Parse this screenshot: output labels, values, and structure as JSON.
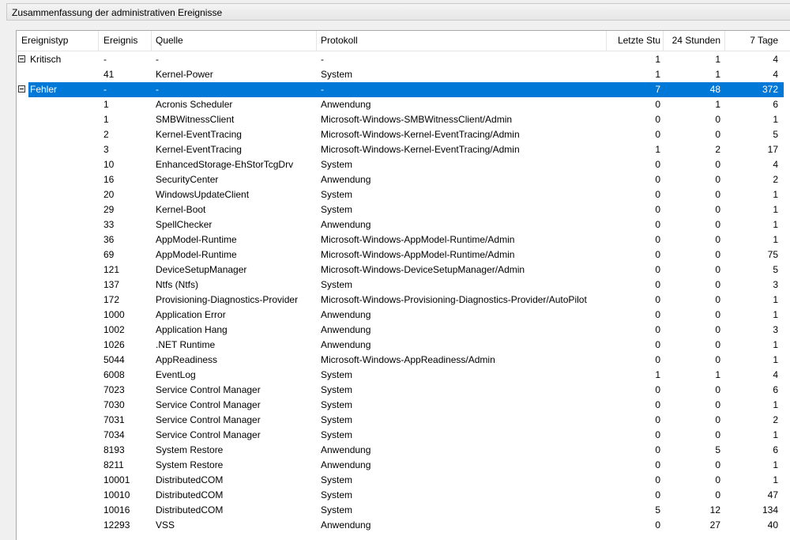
{
  "window": {
    "title": "Zusammenfassung der administrativen Ereignisse"
  },
  "columns": [
    "Ereignistyp",
    "Ereignis",
    "Quelle",
    "Protokoll",
    "Letzte Stu",
    "24 Stunden",
    "7 Tage"
  ],
  "rows": [
    {
      "type": "Kritisch",
      "event": "-",
      "source": "-",
      "log": "-",
      "last": "1",
      "h24": "1",
      "d7": "4",
      "group": true
    },
    {
      "type": "",
      "event": "41",
      "source": "Kernel-Power",
      "log": "System",
      "last": "1",
      "h24": "1",
      "d7": "4"
    },
    {
      "type": "Fehler",
      "event": "-",
      "source": "-",
      "log": "-",
      "last": "7",
      "h24": "48",
      "d7": "372",
      "group": true,
      "selected": true
    },
    {
      "type": "",
      "event": "1",
      "source": "Acronis Scheduler",
      "log": "Anwendung",
      "last": "0",
      "h24": "1",
      "d7": "6"
    },
    {
      "type": "",
      "event": "1",
      "source": "SMBWitnessClient",
      "log": "Microsoft-Windows-SMBWitnessClient/Admin",
      "last": "0",
      "h24": "0",
      "d7": "1"
    },
    {
      "type": "",
      "event": "2",
      "source": "Kernel-EventTracing",
      "log": "Microsoft-Windows-Kernel-EventTracing/Admin",
      "last": "0",
      "h24": "0",
      "d7": "5"
    },
    {
      "type": "",
      "event": "3",
      "source": "Kernel-EventTracing",
      "log": "Microsoft-Windows-Kernel-EventTracing/Admin",
      "last": "1",
      "h24": "2",
      "d7": "17"
    },
    {
      "type": "",
      "event": "10",
      "source": "EnhancedStorage-EhStorTcgDrv",
      "log": "System",
      "last": "0",
      "h24": "0",
      "d7": "4"
    },
    {
      "type": "",
      "event": "16",
      "source": "SecurityCenter",
      "log": "Anwendung",
      "last": "0",
      "h24": "0",
      "d7": "2"
    },
    {
      "type": "",
      "event": "20",
      "source": "WindowsUpdateClient",
      "log": "System",
      "last": "0",
      "h24": "0",
      "d7": "1"
    },
    {
      "type": "",
      "event": "29",
      "source": "Kernel-Boot",
      "log": "System",
      "last": "0",
      "h24": "0",
      "d7": "1"
    },
    {
      "type": "",
      "event": "33",
      "source": "SpellChecker",
      "log": "Anwendung",
      "last": "0",
      "h24": "0",
      "d7": "1"
    },
    {
      "type": "",
      "event": "36",
      "source": "AppModel-Runtime",
      "log": "Microsoft-Windows-AppModel-Runtime/Admin",
      "last": "0",
      "h24": "0",
      "d7": "1"
    },
    {
      "type": "",
      "event": "69",
      "source": "AppModel-Runtime",
      "log": "Microsoft-Windows-AppModel-Runtime/Admin",
      "last": "0",
      "h24": "0",
      "d7": "75"
    },
    {
      "type": "",
      "event": "121",
      "source": "DeviceSetupManager",
      "log": "Microsoft-Windows-DeviceSetupManager/Admin",
      "last": "0",
      "h24": "0",
      "d7": "5"
    },
    {
      "type": "",
      "event": "137",
      "source": "Ntfs (Ntfs)",
      "log": "System",
      "last": "0",
      "h24": "0",
      "d7": "3"
    },
    {
      "type": "",
      "event": "172",
      "source": "Provisioning-Diagnostics-Provider",
      "log": "Microsoft-Windows-Provisioning-Diagnostics-Provider/AutoPilot",
      "last": "0",
      "h24": "0",
      "d7": "1"
    },
    {
      "type": "",
      "event": "1000",
      "source": "Application Error",
      "log": "Anwendung",
      "last": "0",
      "h24": "0",
      "d7": "1"
    },
    {
      "type": "",
      "event": "1002",
      "source": "Application Hang",
      "log": "Anwendung",
      "last": "0",
      "h24": "0",
      "d7": "3"
    },
    {
      "type": "",
      "event": "1026",
      "source": ".NET Runtime",
      "log": "Anwendung",
      "last": "0",
      "h24": "0",
      "d7": "1"
    },
    {
      "type": "",
      "event": "5044",
      "source": "AppReadiness",
      "log": "Microsoft-Windows-AppReadiness/Admin",
      "last": "0",
      "h24": "0",
      "d7": "1"
    },
    {
      "type": "",
      "event": "6008",
      "source": "EventLog",
      "log": "System",
      "last": "1",
      "h24": "1",
      "d7": "4"
    },
    {
      "type": "",
      "event": "7023",
      "source": "Service Control Manager",
      "log": "System",
      "last": "0",
      "h24": "0",
      "d7": "6"
    },
    {
      "type": "",
      "event": "7030",
      "source": "Service Control Manager",
      "log": "System",
      "last": "0",
      "h24": "0",
      "d7": "1"
    },
    {
      "type": "",
      "event": "7031",
      "source": "Service Control Manager",
      "log": "System",
      "last": "0",
      "h24": "0",
      "d7": "2"
    },
    {
      "type": "",
      "event": "7034",
      "source": "Service Control Manager",
      "log": "System",
      "last": "0",
      "h24": "0",
      "d7": "1"
    },
    {
      "type": "",
      "event": "8193",
      "source": "System Restore",
      "log": "Anwendung",
      "last": "0",
      "h24": "5",
      "d7": "6"
    },
    {
      "type": "",
      "event": "8211",
      "source": "System Restore",
      "log": "Anwendung",
      "last": "0",
      "h24": "0",
      "d7": "1"
    },
    {
      "type": "",
      "event": "10001",
      "source": "DistributedCOM",
      "log": "System",
      "last": "0",
      "h24": "0",
      "d7": "1"
    },
    {
      "type": "",
      "event": "10010",
      "source": "DistributedCOM",
      "log": "System",
      "last": "0",
      "h24": "0",
      "d7": "47"
    },
    {
      "type": "",
      "event": "10016",
      "source": "DistributedCOM",
      "log": "System",
      "last": "5",
      "h24": "12",
      "d7": "134"
    },
    {
      "type": "",
      "event": "12293",
      "source": "VSS",
      "log": "Anwendung",
      "last": "0",
      "h24": "27",
      "d7": "40"
    }
  ],
  "colors": {
    "selection": "#0078d7",
    "selection_text": "#ffffff"
  }
}
